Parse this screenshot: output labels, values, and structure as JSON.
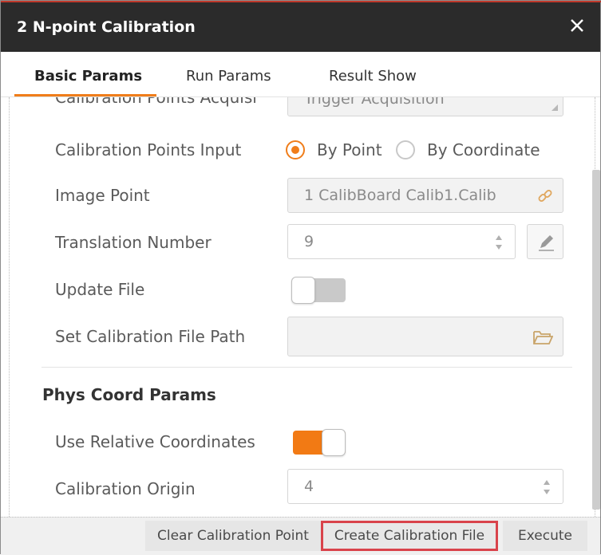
{
  "window": {
    "title": "2 N-point Calibration",
    "accent_color": "#f07d1a",
    "highlight_color": "#d9434b",
    "close_icon": "close-icon"
  },
  "tabs": [
    {
      "label": "Basic Params",
      "active": true
    },
    {
      "label": "Run Params",
      "active": false
    },
    {
      "label": "Result Show",
      "active": false
    }
  ],
  "params": {
    "acquisition": {
      "label": "Calibration Points Acquisi",
      "value": "Trigger Acquisition"
    },
    "points_input": {
      "label": "Calibration Points Input",
      "options": [
        {
          "label": "By Point",
          "selected": true
        },
        {
          "label": "By Coordinate",
          "selected": false
        }
      ]
    },
    "image_point": {
      "label": "Image Point",
      "value": "1 CalibBoard Calib1.Calib",
      "icon": "link-icon"
    },
    "translation_number": {
      "label": "Translation Number",
      "value": "9",
      "edit_icon": "pencil-icon"
    },
    "update_file": {
      "label": "Update File",
      "enabled": false
    },
    "file_path": {
      "label": "Set Calibration File Path",
      "value": "",
      "icon": "folder-icon"
    }
  },
  "phys_coord": {
    "section_title": "Phys Coord Params",
    "relative": {
      "label": "Use Relative Coordinates",
      "enabled": true
    },
    "origin": {
      "label": "Calibration Origin",
      "value": "4"
    }
  },
  "footer": {
    "clear": "Clear Calibration Point",
    "create": "Create Calibration File",
    "execute": "Execute"
  }
}
